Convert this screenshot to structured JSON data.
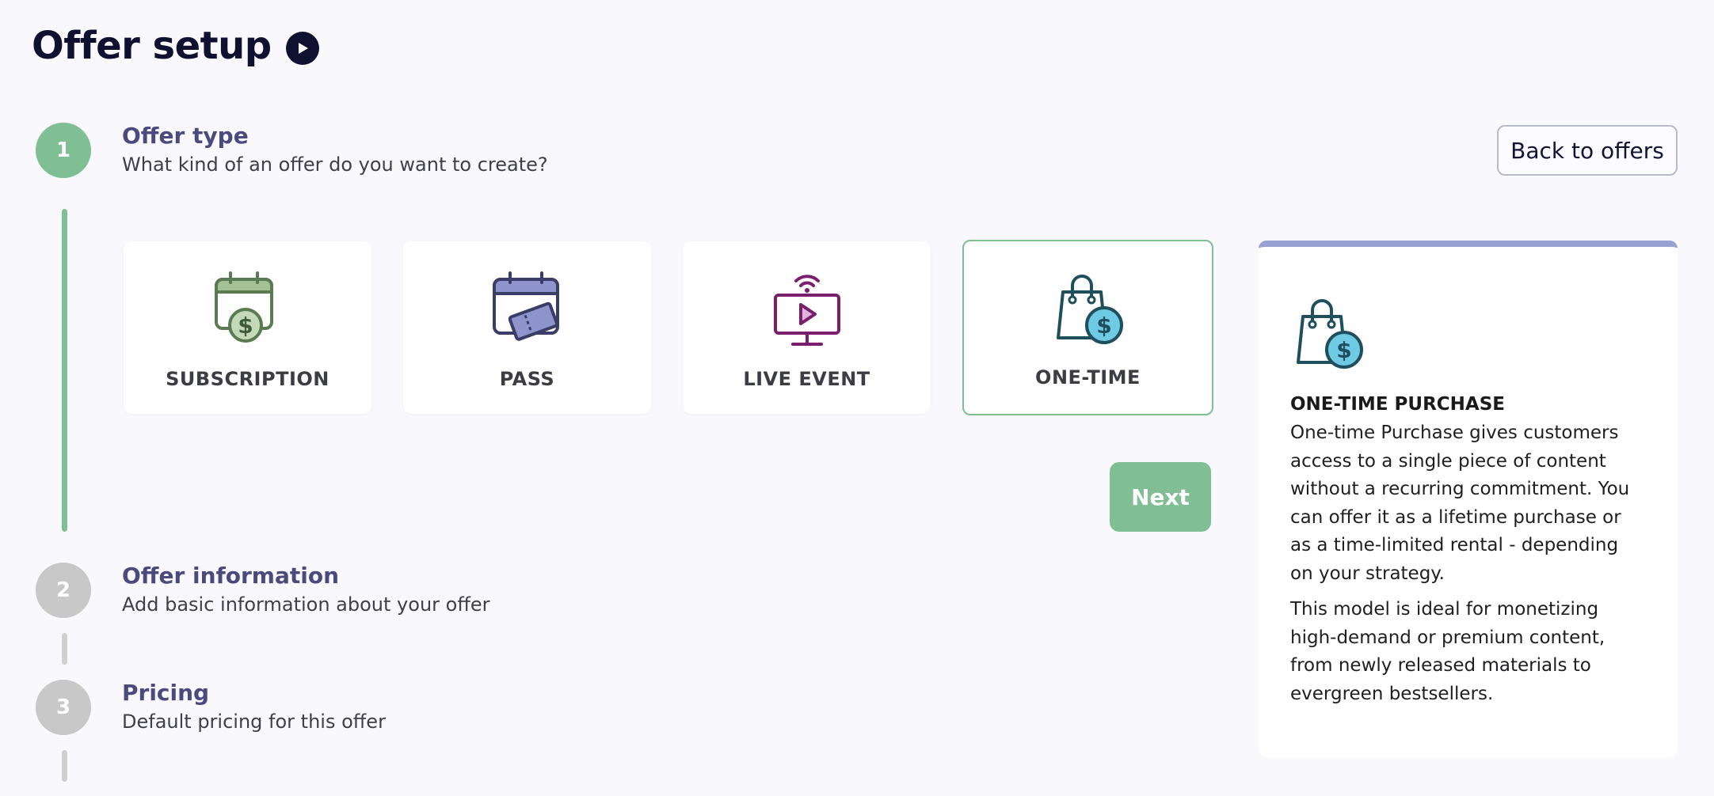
{
  "header": {
    "title": "Offer setup"
  },
  "steps": [
    {
      "number": "1",
      "title": "Offer type",
      "subtitle": "What kind of an offer do you want to create?"
    },
    {
      "number": "2",
      "title": "Offer information",
      "subtitle": "Add basic information about your offer"
    },
    {
      "number": "3",
      "title": "Pricing",
      "subtitle": "Default pricing for this offer"
    }
  ],
  "actions": {
    "back_label": "Back to offers",
    "next_label": "Next"
  },
  "offer_types": [
    {
      "label": "SUBSCRIPTION",
      "icon": "calendar-dollar-icon"
    },
    {
      "label": "PASS",
      "icon": "calendar-ticket-icon"
    },
    {
      "label": "LIVE EVENT",
      "icon": "broadcast-monitor-icon"
    },
    {
      "label": "ONE-TIME",
      "icon": "shopping-bag-dollar-icon",
      "selected": true
    }
  ],
  "info": {
    "heading": "ONE-TIME PURCHASE",
    "paragraph1": "One-time Purchase gives customers access to a single piece of content without a recurring commitment. You can offer it as a lifetime purchase or as a time-limited rental - depending on your strategy.",
    "paragraph2": "This model is ideal for monetizing high-demand or premium content, from newly released materials to evergreen bestsellers."
  },
  "colors": {
    "accent_green": "#7fbf93",
    "step_title": "#4b4a7c",
    "inactive_gray": "#c8c8c8",
    "panel_top": "#97a1d2"
  }
}
